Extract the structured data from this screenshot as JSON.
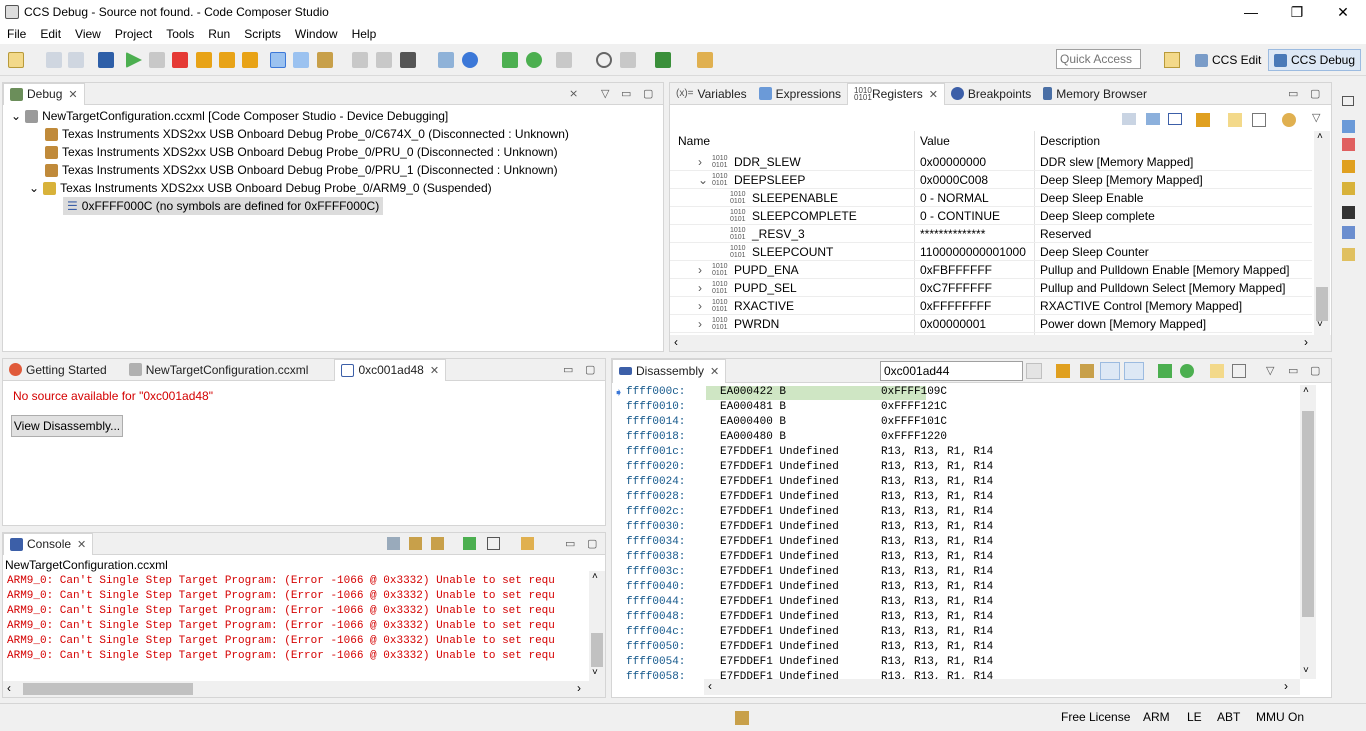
{
  "window": {
    "title": "CCS Debug - Source not found. - Code Composer Studio"
  },
  "menu": [
    "File",
    "Edit",
    "View",
    "Project",
    "Tools",
    "Run",
    "Scripts",
    "Window",
    "Help"
  ],
  "toolbar": {
    "quick_access_placeholder": "Quick Access",
    "persp_edit": "CCS Edit",
    "persp_debug": "CCS Debug"
  },
  "debug_view": {
    "tab": "Debug",
    "root": "NewTargetConfiguration.ccxml [Code Composer Studio - Device Debugging]",
    "items": [
      "Texas Instruments XDS2xx USB Onboard Debug Probe_0/C674X_0 (Disconnected : Unknown)",
      "Texas Instruments XDS2xx USB Onboard Debug Probe_0/PRU_0 (Disconnected : Unknown)",
      "Texas Instruments XDS2xx USB Onboard Debug Probe_0/PRU_1 (Disconnected : Unknown)",
      "Texas Instruments XDS2xx USB Onboard Debug Probe_0/ARM9_0 (Suspended)"
    ],
    "frame": "0xFFFF000C  (no symbols are defined for 0xFFFF000C)"
  },
  "registers_view": {
    "tabs": [
      "Variables",
      "Expressions",
      "Registers",
      "Breakpoints",
      "Memory Browser"
    ],
    "columns": [
      "Name",
      "Value",
      "Description"
    ],
    "rows": [
      {
        "name": "DDR_SLEW",
        "value": "0x00000000",
        "desc": "DDR slew [Memory Mapped]",
        "expander": "›",
        "child": false
      },
      {
        "name": "DEEPSLEEP",
        "value": "0x0000C008",
        "desc": "Deep Sleep [Memory Mapped]",
        "expander": "⌄",
        "child": false
      },
      {
        "name": "SLEEPENABLE",
        "value": "0 - NORMAL",
        "desc": "Deep Sleep Enable",
        "expander": "",
        "child": true
      },
      {
        "name": "SLEEPCOMPLETE",
        "value": "0 - CONTINUE",
        "desc": "Deep Sleep complete",
        "expander": "",
        "child": true
      },
      {
        "name": "_RESV_3",
        "value": "**************",
        "desc": "Reserved",
        "expander": "",
        "child": true
      },
      {
        "name": "SLEEPCOUNT",
        "value": "1100000000001000",
        "desc": "Deep Sleep Counter",
        "expander": "",
        "child": true
      },
      {
        "name": "PUPD_ENA",
        "value": "0xFBFFFFFF",
        "desc": "Pullup and Pulldown Enable [Memory Mapped]",
        "expander": "›",
        "child": false
      },
      {
        "name": "PUPD_SEL",
        "value": "0xC7FFFFFF",
        "desc": "Pullup and Pulldown Select [Memory Mapped]",
        "expander": "›",
        "child": false
      },
      {
        "name": "RXACTIVE",
        "value": "0xFFFFFFFF",
        "desc": "RXACTIVE Control [Memory Mapped]",
        "expander": "›",
        "child": false
      },
      {
        "name": "PWRDN",
        "value": "0x00000001",
        "desc": "Power down [Memory Mapped]",
        "expander": "›",
        "child": false
      }
    ]
  },
  "editor": {
    "tabs": [
      "Getting Started",
      "NewTargetConfiguration.ccxml",
      "0xc001ad48"
    ],
    "message": "No source available for \"0xc001ad48\"",
    "button": "View Disassembly..."
  },
  "console": {
    "tab": "Console",
    "target": "NewTargetConfiguration.ccxml",
    "lines": [
      "ARM9_0: Can't Single Step Target Program: (Error -1066 @ 0x3332) Unable to set requ",
      "ARM9_0: Can't Single Step Target Program: (Error -1066 @ 0x3332) Unable to set requ",
      "ARM9_0: Can't Single Step Target Program: (Error -1066 @ 0x3332) Unable to set requ",
      "ARM9_0: Can't Single Step Target Program: (Error -1066 @ 0x3332) Unable to set requ",
      "ARM9_0: Can't Single Step Target Program: (Error -1066 @ 0x3332) Unable to set requ",
      "ARM9_0: Can't Single Step Target Program: (Error -1066 @ 0x3332) Unable to set requ"
    ]
  },
  "disassembly": {
    "tab": "Disassembly",
    "address_input": "0xc001ad44",
    "rows": [
      {
        "addr": "ffff000c:",
        "op": "EA000422 B",
        "args": "0xFFFF109C"
      },
      {
        "addr": "ffff0010:",
        "op": "EA000481 B",
        "args": "0xFFFF121C"
      },
      {
        "addr": "ffff0014:",
        "op": "EA000400 B",
        "args": "0xFFFF101C"
      },
      {
        "addr": "ffff0018:",
        "op": "EA000480 B",
        "args": "0xFFFF1220"
      },
      {
        "addr": "ffff001c:",
        "op": "E7FDDEF1 Undefined",
        "args": "R13, R13, R1, R14"
      },
      {
        "addr": "ffff0020:",
        "op": "E7FDDEF1 Undefined",
        "args": "R13, R13, R1, R14"
      },
      {
        "addr": "ffff0024:",
        "op": "E7FDDEF1 Undefined",
        "args": "R13, R13, R1, R14"
      },
      {
        "addr": "ffff0028:",
        "op": "E7FDDEF1 Undefined",
        "args": "R13, R13, R1, R14"
      },
      {
        "addr": "ffff002c:",
        "op": "E7FDDEF1 Undefined",
        "args": "R13, R13, R1, R14"
      },
      {
        "addr": "ffff0030:",
        "op": "E7FDDEF1 Undefined",
        "args": "R13, R13, R1, R14"
      },
      {
        "addr": "ffff0034:",
        "op": "E7FDDEF1 Undefined",
        "args": "R13, R13, R1, R14"
      },
      {
        "addr": "ffff0038:",
        "op": "E7FDDEF1 Undefined",
        "args": "R13, R13, R1, R14"
      },
      {
        "addr": "ffff003c:",
        "op": "E7FDDEF1 Undefined",
        "args": "R13, R13, R1, R14"
      },
      {
        "addr": "ffff0040:",
        "op": "E7FDDEF1 Undefined",
        "args": "R13, R13, R1, R14"
      },
      {
        "addr": "ffff0044:",
        "op": "E7FDDEF1 Undefined",
        "args": "R13, R13, R1, R14"
      },
      {
        "addr": "ffff0048:",
        "op": "E7FDDEF1 Undefined",
        "args": "R13, R13, R1, R14"
      },
      {
        "addr": "ffff004c:",
        "op": "E7FDDEF1 Undefined",
        "args": "R13, R13, R1, R14"
      },
      {
        "addr": "ffff0050:",
        "op": "E7FDDEF1 Undefined",
        "args": "R13, R13, R1, R14"
      },
      {
        "addr": "ffff0054:",
        "op": "E7FDDEF1 Undefined",
        "args": "R13, R13, R1, R14"
      },
      {
        "addr": "ffff0058:",
        "op": "E7FDDEF1 Undefined",
        "args": "R13, R13, R1, R14"
      }
    ]
  },
  "status": {
    "license": "Free License",
    "arch": "ARM",
    "endian": "LE",
    "mode": "ABT",
    "mmu": "MMU On"
  },
  "colors": {
    "accent": "#3c78d8",
    "pc_highlight": "#cfe6c4",
    "error_red": "#d40000",
    "selection": "#dcdcdc"
  }
}
